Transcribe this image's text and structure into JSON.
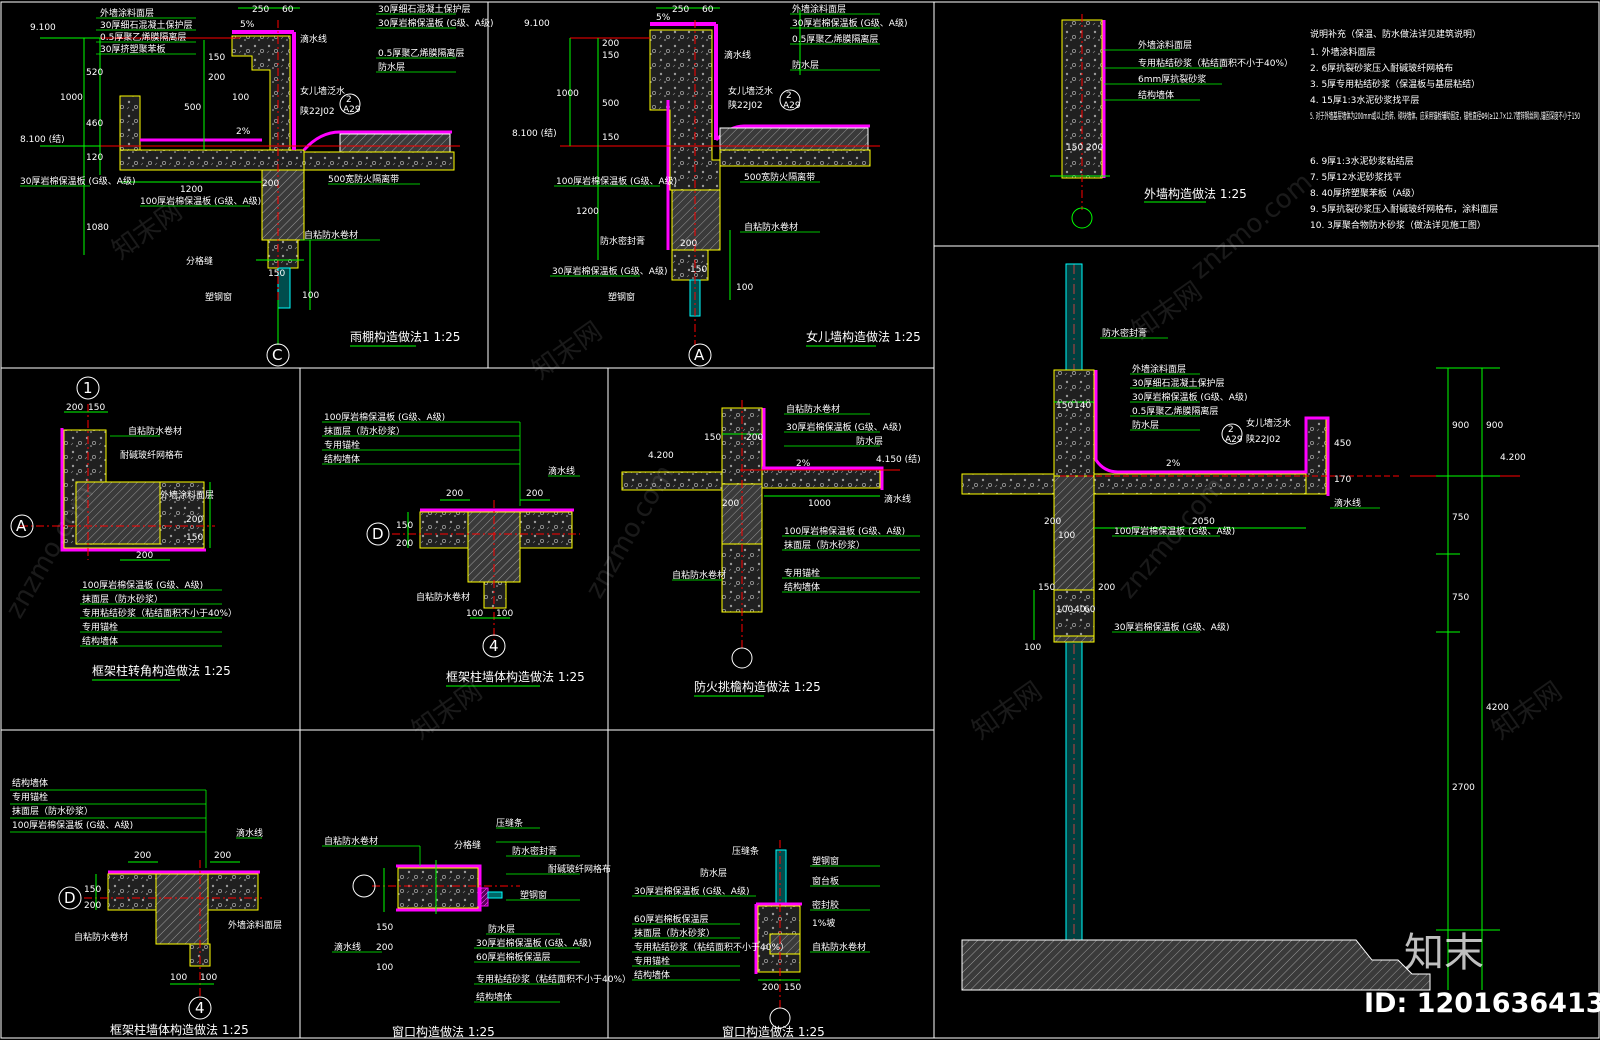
{
  "colors": {
    "background": "#000000",
    "frame": "#ffffff",
    "dimension": "#00ff00",
    "axis": "#ff0000",
    "insulation": "#ff00ff",
    "finish": "#ffff00",
    "concrete": "#808080",
    "cyan": "#00ffff"
  },
  "details": {
    "canopy": {
      "title": "雨棚构造做法1 1:25",
      "bubble": "C",
      "elev_top": "9.100",
      "elev_floor": "8.100 (结)",
      "dims": [
        "250",
        "60",
        "150",
        "200",
        "520",
        "1000",
        "460",
        "120",
        "1200",
        "1080",
        "500",
        "100",
        "200",
        "150",
        "100"
      ]
    },
    "parapet": {
      "title": "女儿墙构造做法 1:25",
      "bubble": "A",
      "elev_top": "9.100",
      "elev_floor": "8.100 (结)",
      "dims": [
        "250",
        "60",
        "150",
        "200",
        "1000",
        "500",
        "150",
        "1200",
        "200",
        "100",
        "150"
      ]
    },
    "wall": {
      "title": "外墙构造做法 1:25",
      "dims": [
        "150",
        "200"
      ]
    },
    "col_corner": {
      "title": "框架柱转角构造做法 1:25",
      "bubble_top": "1",
      "bubble_side": "A",
      "dims": [
        "200",
        "150",
        "200",
        "150",
        "200"
      ]
    },
    "col_t": {
      "title": "框架柱墙体构造做法 1:25",
      "bubble_side": "D",
      "bubble_bottom": "4",
      "dims": [
        "200",
        "200",
        "150",
        "200",
        "100",
        "100"
      ]
    },
    "fire": {
      "title": "防火挑檐构造做法 1:25",
      "elev_left": "4.200",
      "elev_right": "4.150 (结)",
      "dims": [
        "150",
        "200",
        "200",
        "1000",
        "2%"
      ]
    },
    "section": {
      "elev_right": "4.200",
      "dims_right_a": [
        "900",
        "750",
        "750",
        "2700"
      ],
      "dims_right_b": [
        "900",
        "4200"
      ],
      "dims_misc": [
        "150",
        "140",
        "200",
        "100",
        "2050",
        "150",
        "200",
        "100",
        "40",
        "60",
        "100",
        "450",
        "170"
      ],
      "ref": "A29",
      "ref_sub": "2"
    },
    "col_t2": {
      "title": "框架柱墙体构造做法 1:25",
      "bubble_side": "D",
      "bubble_bottom": "4",
      "dims": [
        "200",
        "200",
        "150",
        "200",
        "100",
        "100"
      ]
    },
    "window1": {
      "title": "窗口构造做法 1:25",
      "dims": [
        "100",
        "200",
        "150"
      ]
    },
    "window2": {
      "title": "窗口构造做法 1:25",
      "dims": [
        "200",
        "150"
      ]
    }
  },
  "notes": {
    "heading": "说明补充（保温、防水做法详见建筑说明）",
    "items": [
      "1. 外墙涂料面层",
      "2. 6厚抗裂砂浆压入耐碱玻纤网格布",
      "3. 5厚专用粘结砂浆（保温板与基层粘结）",
      "4. 15厚1:3水泥砂浆找平层",
      "5. 对于外墙基层墙体为200mm或以上的砖、砌块墙体，应采用锚栓辅助固定，锚栓直径Φ9(≥12.7×12.7镀锌钢丝网),锚固深度不小于150",
      "6. 9厚1:3水泥砂浆粘结层",
      "7. 5厚12水泥砂浆找平",
      "8. 40厚挤塑聚苯板（A级）",
      "9. 5厚抗裂砂浆压入耐碱玻纤网格布，涂料面层",
      "10. 3厚聚合物防水砂浆（做法详见施工图）"
    ]
  },
  "labels": {
    "l1": "外墙涂料面层",
    "l2": "30厚细石混凝土保护层",
    "l3": "0.5厚聚乙烯膜隔离层",
    "l4": "30厚挤塑聚苯板",
    "l5": "保温层",
    "l6": "100厚岩棉保温板 (G级、A级)",
    "l7": "30厚岩棉保温板 (G级、A级)",
    "l8": "500宽防火隔离带",
    "l9": "防水层",
    "l10": "自粘防水卷材",
    "l11": "滴水线",
    "l12": "分格缝",
    "l13": "塑钢窗",
    "l14": "防水密封膏",
    "l15": "耐碱玻纤网格布",
    "l16": "专用锚栓",
    "l17": "专用粘结砂浆（粘结面积不小于40%）",
    "l18": "6mm厚抗裂砂浆",
    "l19": "抹面层（防水砂浆）",
    "l20": "压缝条",
    "l21": "60厚岩棉板保温层",
    "l22": "结构墙体",
    "l23": "窗台板",
    "l24": "密封胶",
    "l25": "1%坡",
    "l26": "2%",
    "l27": "5%"
  },
  "refs": {
    "a29": "A29",
    "code": "陕22J02",
    "num": "2",
    "ref_text": "女儿墙泛水"
  },
  "watermark": {
    "site": "知末网",
    "url": "znzmo.com",
    "brand": "知末",
    "id": "ID: 1201636413"
  }
}
